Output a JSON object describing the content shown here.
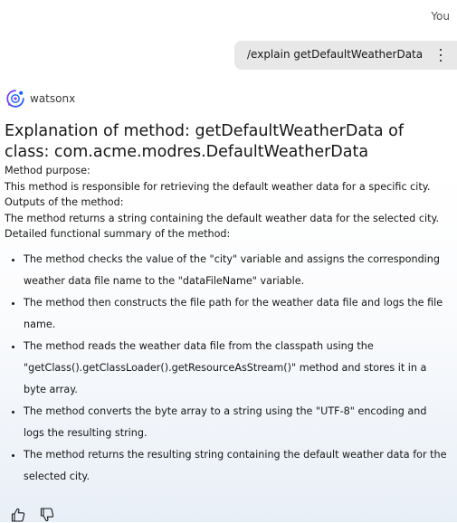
{
  "user": {
    "name": "You",
    "message": "/explain getDefaultWeatherData"
  },
  "agent": {
    "name": "watsonx",
    "avatar_icon": "watsonx-logo-icon"
  },
  "response": {
    "title": "Explanation of method: getDefaultWeatherData of class: com.acme.modres.DefaultWeatherData",
    "paragraphs": [
      "Method purpose:",
      "This method is responsible for retrieving the default weather data for a specific city.",
      "Outputs of the method:",
      "The method returns a string containing the default weather data for the selected city.",
      "Detailed functional summary of the method:"
    ],
    "summary_items": [
      "The method checks the value of the \"city\" variable and assigns the corresponding weather data file name to the \"dataFileName\" variable.",
      "The method then constructs the file path for the weather data file and logs the file name.",
      "The method reads the weather data file from the classpath using the \"getClass().getClassLoader().getResourceAsStream()\" method and stores it in a byte array.",
      "The method converts the byte array to a string using the \"UTF-8\" encoding and logs the resulting string.",
      "The method returns the resulting string containing the default weather data for the selected city."
    ]
  },
  "feedback": {
    "thumbs_up_icon": "thumbs-up-icon",
    "thumbs_down_icon": "thumbs-down-icon"
  },
  "colors": {
    "bubble": "#e8e8e8",
    "text": "#161616",
    "avatar_blue": "#0f62fe",
    "avatar_purple": "#8a3ffc"
  }
}
